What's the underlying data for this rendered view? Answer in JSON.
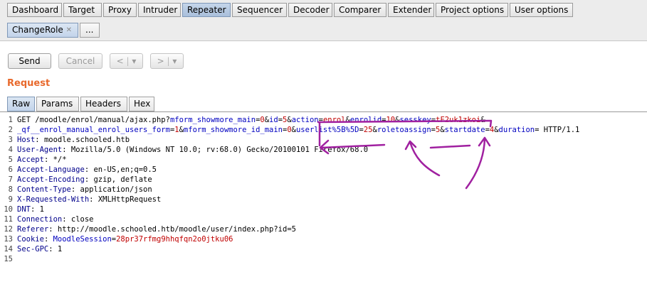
{
  "top_tabs": [
    "Dashboard",
    "Target",
    "Proxy",
    "Intruder",
    "Repeater",
    "Sequencer",
    "Decoder",
    "Comparer",
    "Extender",
    "Project options",
    "User options"
  ],
  "sub_tabs": [
    "ChangeRole",
    "..."
  ],
  "buttons": {
    "send": "Send",
    "cancel": "Cancel",
    "prev": "<",
    "prev_menu": "▾",
    "next": ">",
    "next_menu": "▾"
  },
  "section_title": "Request",
  "request_tabs": [
    "Raw",
    "Params",
    "Headers",
    "Hex"
  ],
  "line_numbers": [
    "1",
    "2",
    "3",
    "4",
    "5",
    "6",
    "7",
    "8",
    "9",
    "10",
    "11",
    "12",
    "13",
    "14",
    "15"
  ],
  "request": {
    "method": "GET",
    "path": "/moodle/enrol/manual/ajax.php?",
    "params": [
      {
        "name": "mform_showmore_main",
        "value": "0"
      },
      {
        "name": "id",
        "value": "5"
      },
      {
        "name": "action",
        "value": "enrol"
      },
      {
        "name": "enrolid",
        "value": "10"
      },
      {
        "name": "sesskey",
        "value": "tF2uk1zkoi"
      },
      {
        "name": "_qf__enrol_manual_enrol_users_form",
        "value": "1"
      },
      {
        "name": "mform_showmore_id_main",
        "value": "0"
      },
      {
        "name": "userlist%5B%5D",
        "value": "25"
      },
      {
        "name": "roletoassign",
        "value": "5"
      },
      {
        "name": "startdate",
        "value": "4"
      },
      {
        "name": "duration",
        "value": ""
      }
    ],
    "protocol": " HTTP/1.1",
    "headers": [
      {
        "name": "Host",
        "value": "moodle.schooled.htb"
      },
      {
        "name": "User-Agent",
        "value": "Mozilla/5.0 (Windows NT 10.0; rv:68.0) Gecko/20100101 Firefox/68.0"
      },
      {
        "name": "Accept",
        "value": "*/*"
      },
      {
        "name": "Accept-Language",
        "value": "en-US,en;q=0.5"
      },
      {
        "name": "Accept-Encoding",
        "value": "gzip, deflate"
      },
      {
        "name": "Content-Type",
        "value": "application/json"
      },
      {
        "name": "X-Requested-With",
        "value": "XMLHttpRequest"
      },
      {
        "name": "DNT",
        "value": "1"
      },
      {
        "name": "Connection",
        "value": "close"
      },
      {
        "name": "Referer",
        "value": "http://moodle.schooled.htb/moodle/user/index.php?id=5"
      }
    ],
    "cookie": {
      "name": "Cookie",
      "cookie_name": "MoodleSession",
      "cookie_value": "28pr37rfmg9hhqfqn2o0jtku06"
    },
    "sec_gpc": {
      "name": "Sec-GPC",
      "value": "1"
    }
  },
  "colors": {
    "accent": "#e8692c",
    "param_name": "#0000c0",
    "param_value": "#c00000",
    "annotation": "#a020a0"
  }
}
